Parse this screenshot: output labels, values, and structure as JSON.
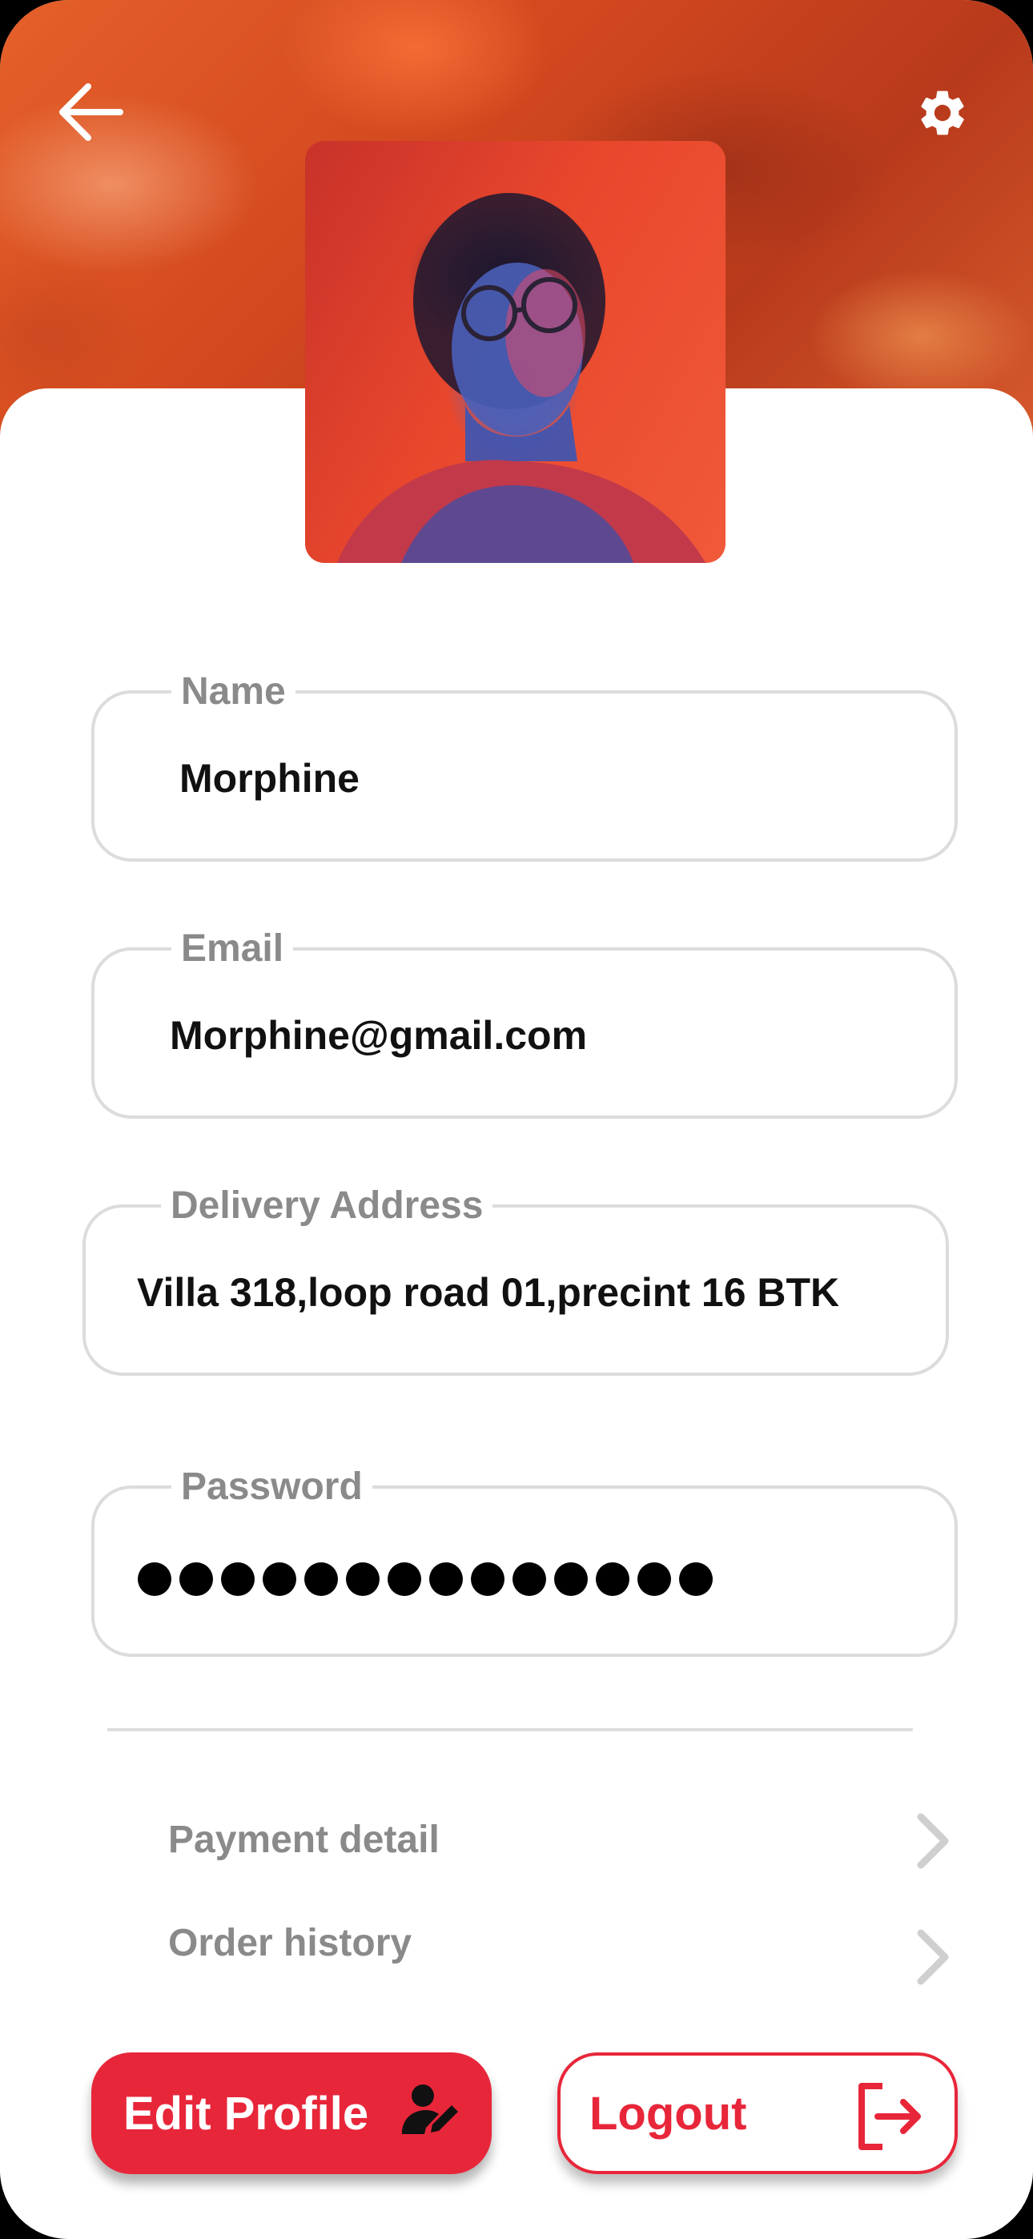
{
  "header": {
    "back_icon": "arrow-left-icon",
    "settings_icon": "gear-icon"
  },
  "profile": {
    "avatar": "profile-photo"
  },
  "fields": {
    "name": {
      "label": "Name",
      "value": "Morphine"
    },
    "email": {
      "label": "Email",
      "value": "Morphine@gmail.com"
    },
    "address": {
      "label": "Delivery Address",
      "value": "Villa 318,loop road 01,precint 16 BTK"
    },
    "password": {
      "label": "Password",
      "masked_length": 14
    }
  },
  "menu": {
    "payment": {
      "label": "Payment detail",
      "icon": "chevron-right-icon"
    },
    "orders": {
      "label": "Order history",
      "icon": "chevron-right-icon"
    }
  },
  "actions": {
    "edit_label": "Edit Profile",
    "edit_icon": "user-edit-icon",
    "logout_label": "Logout",
    "logout_icon": "logout-icon"
  },
  "colors": {
    "accent": "#e8263a",
    "muted_text": "#8a8a8a",
    "border": "#dcdcdc"
  }
}
